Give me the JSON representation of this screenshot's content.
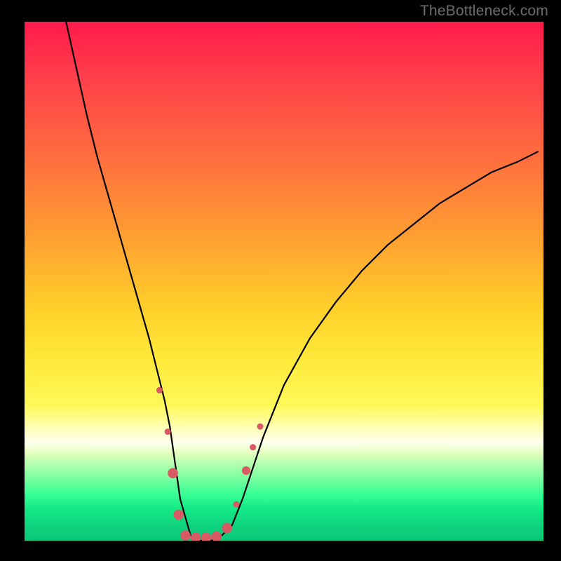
{
  "watermark": {
    "text": "TheBottleneck.com"
  },
  "colors": {
    "background": "#000000",
    "curve": "#000000",
    "marker_fill": "#d85a62",
    "marker_stroke": "#d85a62",
    "gradient_top": "#ff1a4b",
    "gradient_bottom": "#0cc878"
  },
  "chart_data": {
    "type": "line",
    "title": "",
    "xlabel": "",
    "ylabel": "",
    "xlim": [
      0,
      100
    ],
    "ylim": [
      0,
      100
    ],
    "grid": false,
    "legend": null,
    "note": "Values are read approximately from pixel positions; chart has no numeric tick labels.",
    "series": [
      {
        "name": "curve",
        "x": [
          8,
          10,
          12,
          14,
          16,
          18,
          20,
          22,
          24,
          26,
          27,
          28,
          29,
          30,
          32,
          34,
          36,
          38,
          40,
          42,
          44,
          46,
          50,
          55,
          60,
          65,
          70,
          75,
          80,
          85,
          90,
          95,
          99
        ],
        "y": [
          100,
          91,
          82,
          74,
          67,
          60,
          53,
          46,
          39,
          31,
          27,
          22,
          15,
          8,
          1,
          0,
          0,
          1,
          3,
          8,
          14,
          20,
          30,
          39,
          46,
          52,
          57,
          61,
          65,
          68,
          71,
          73,
          75
        ]
      }
    ],
    "markers": [
      {
        "x": 26.0,
        "y": 29.0,
        "r": 1.1
      },
      {
        "x": 27.6,
        "y": 21.0,
        "r": 1.1
      },
      {
        "x": 28.6,
        "y": 13.0,
        "r": 1.8
      },
      {
        "x": 29.7,
        "y": 5.0,
        "r": 1.8
      },
      {
        "x": 31.0,
        "y": 1.0,
        "r": 1.8
      },
      {
        "x": 33.0,
        "y": 0.6,
        "r": 1.8
      },
      {
        "x": 35.0,
        "y": 0.6,
        "r": 1.8
      },
      {
        "x": 37.0,
        "y": 0.8,
        "r": 1.8
      },
      {
        "x": 39.0,
        "y": 2.4,
        "r": 1.8
      },
      {
        "x": 40.8,
        "y": 7.0,
        "r": 1.1
      },
      {
        "x": 42.7,
        "y": 13.5,
        "r": 1.5
      },
      {
        "x": 44.0,
        "y": 18.0,
        "r": 1.1
      },
      {
        "x": 45.4,
        "y": 22.0,
        "r": 1.1
      }
    ]
  }
}
